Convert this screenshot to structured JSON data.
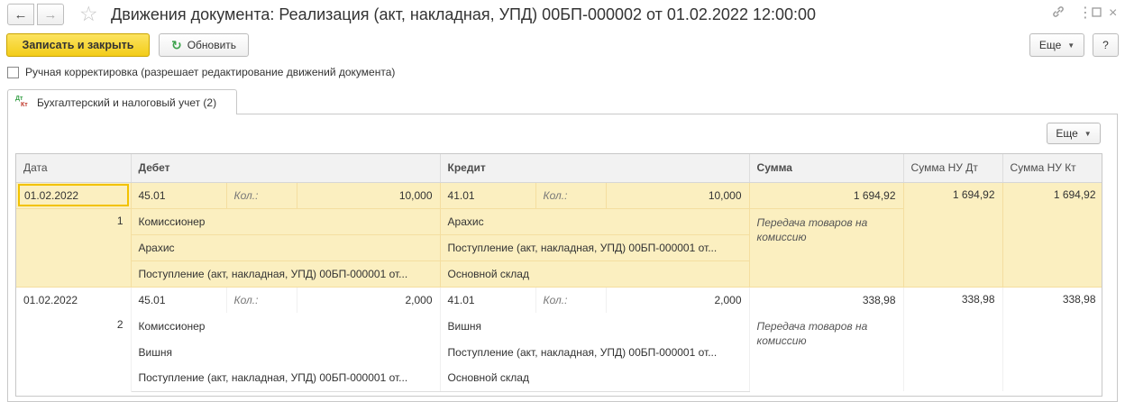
{
  "window": {
    "title": "Движения документа: Реализация (акт, накладная, УПД) 00БП-000002 от 01.02.2022 12:00:00",
    "link_icon": "link-icon",
    "menu_icon": "more-vertical-icon",
    "maximize_icon": "maximize-icon",
    "close_icon": "close-icon"
  },
  "toolbar": {
    "save_close": "Записать и закрыть",
    "refresh": "Обновить",
    "more": "Еще",
    "help": "?"
  },
  "manual_edit_label": "Ручная корректировка (разрешает редактирование движений документа)",
  "tab": {
    "label": "Бухгалтерский и налоговый учет (2)"
  },
  "panel": {
    "more": "Еще"
  },
  "grid": {
    "columns": [
      "Дата",
      "Дебет",
      "Кредит",
      "Сумма",
      "Сумма НУ Дт",
      "Сумма НУ Кт"
    ],
    "qty_label": "Кол.:",
    "rows": [
      {
        "date": "01.02.2022",
        "num": "1",
        "debit": {
          "account": "45.01",
          "qty": "10,000",
          "sub1": "Комиссионер",
          "sub2": "Арахис",
          "sub3": "Поступление (акт, накладная, УПД) 00БП-000001 от..."
        },
        "credit": {
          "account": "41.01",
          "qty": "10,000",
          "sub1": "Арахис",
          "sub2": "Поступление (акт, накладная, УПД) 00БП-000001 от...",
          "sub3": "Основной склад"
        },
        "sum": "1 694,92",
        "purpose": "Передача товаров на комиссию",
        "nu_dt": "1 694,92",
        "nu_kt": "1 694,92"
      },
      {
        "date": "01.02.2022",
        "num": "2",
        "debit": {
          "account": "45.01",
          "qty": "2,000",
          "sub1": "Комиссионер",
          "sub2": "Вишня",
          "sub3": "Поступление (акт, накладная, УПД) 00БП-000001 от..."
        },
        "credit": {
          "account": "41.01",
          "qty": "2,000",
          "sub1": "Вишня",
          "sub2": "Поступление (акт, накладная, УПД) 00БП-000001 от...",
          "sub3": "Основной склад"
        },
        "sum": "338,98",
        "purpose": "Передача товаров на комиссию",
        "nu_dt": "338,98",
        "nu_kt": "338,98"
      }
    ]
  }
}
